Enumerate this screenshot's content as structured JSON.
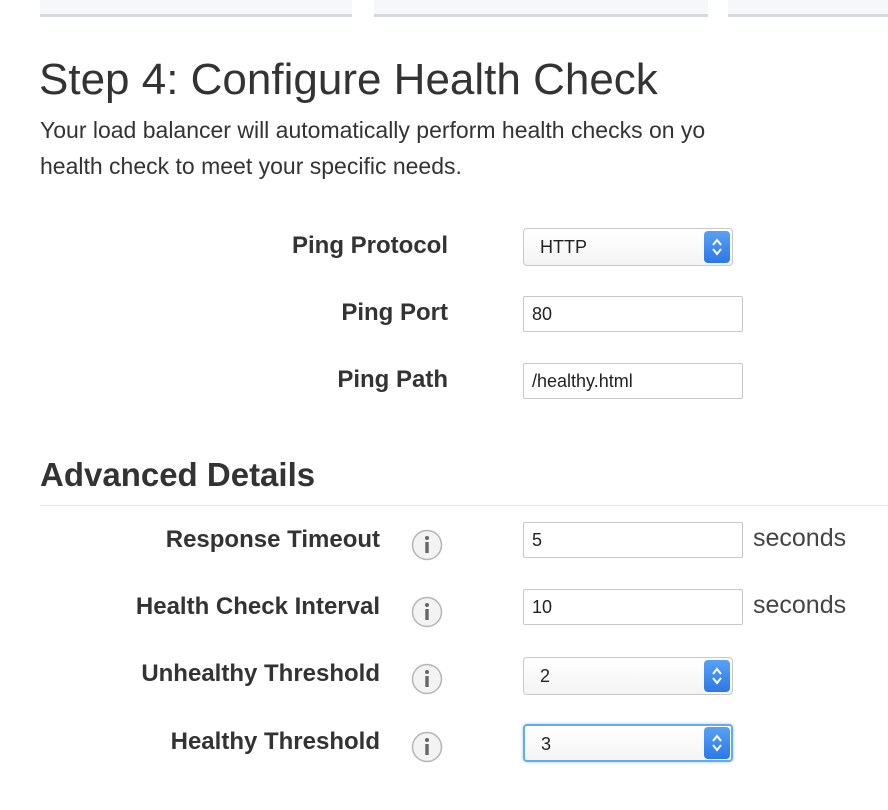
{
  "header": {
    "title": "Step 4: Configure Health Check",
    "description_line1": "Your load balancer will automatically perform health checks on yo",
    "description_line2": "health check to meet your specific needs."
  },
  "health_check": {
    "ping_protocol": {
      "label": "Ping Protocol",
      "value": "HTTP"
    },
    "ping_port": {
      "label": "Ping Port",
      "value": "80"
    },
    "ping_path": {
      "label": "Ping Path",
      "value": "/healthy.html"
    }
  },
  "advanced": {
    "title": "Advanced Details",
    "response_timeout": {
      "label": "Response Timeout",
      "value": "5",
      "unit": "seconds"
    },
    "interval": {
      "label": "Health Check Interval",
      "value": "10",
      "unit": "seconds"
    },
    "unhealthy_threshold": {
      "label": "Unhealthy Threshold",
      "value": "2"
    },
    "healthy_threshold": {
      "label": "Healthy Threshold",
      "value": "3"
    }
  },
  "colors": {
    "stepper": "#3b87ef",
    "focus": "#6aa9e8",
    "text": "#333333"
  },
  "icons": {
    "info": "info-icon",
    "select_arrows": "chevron-up-down-icon"
  }
}
